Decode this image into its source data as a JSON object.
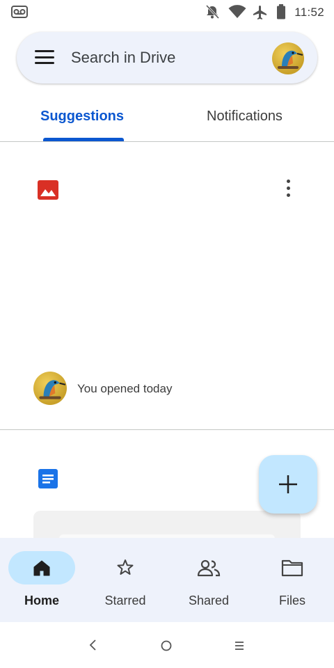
{
  "status_bar": {
    "time": "11:52"
  },
  "search": {
    "placeholder": "Search in Drive"
  },
  "tabs": [
    {
      "label": "Suggestions",
      "active": true
    },
    {
      "label": "Notifications",
      "active": false
    }
  ],
  "suggestions": [
    {
      "file_icon": "image-icon",
      "icon_color": "#d93025",
      "reason": "You opened today"
    },
    {
      "file_icon": "doc-icon",
      "icon_color": "#1a73e8"
    }
  ],
  "fab": {
    "icon": "plus-icon"
  },
  "bottom_nav": [
    {
      "label": "Home",
      "icon": "home-icon",
      "active": true
    },
    {
      "label": "Starred",
      "icon": "star-icon",
      "active": false
    },
    {
      "label": "Shared",
      "icon": "people-icon",
      "active": false
    },
    {
      "label": "Files",
      "icon": "folder-icon",
      "active": false
    }
  ],
  "colors": {
    "accent": "#0b57d0",
    "surface": "#eef2fb",
    "fab": "#c2e7ff"
  }
}
